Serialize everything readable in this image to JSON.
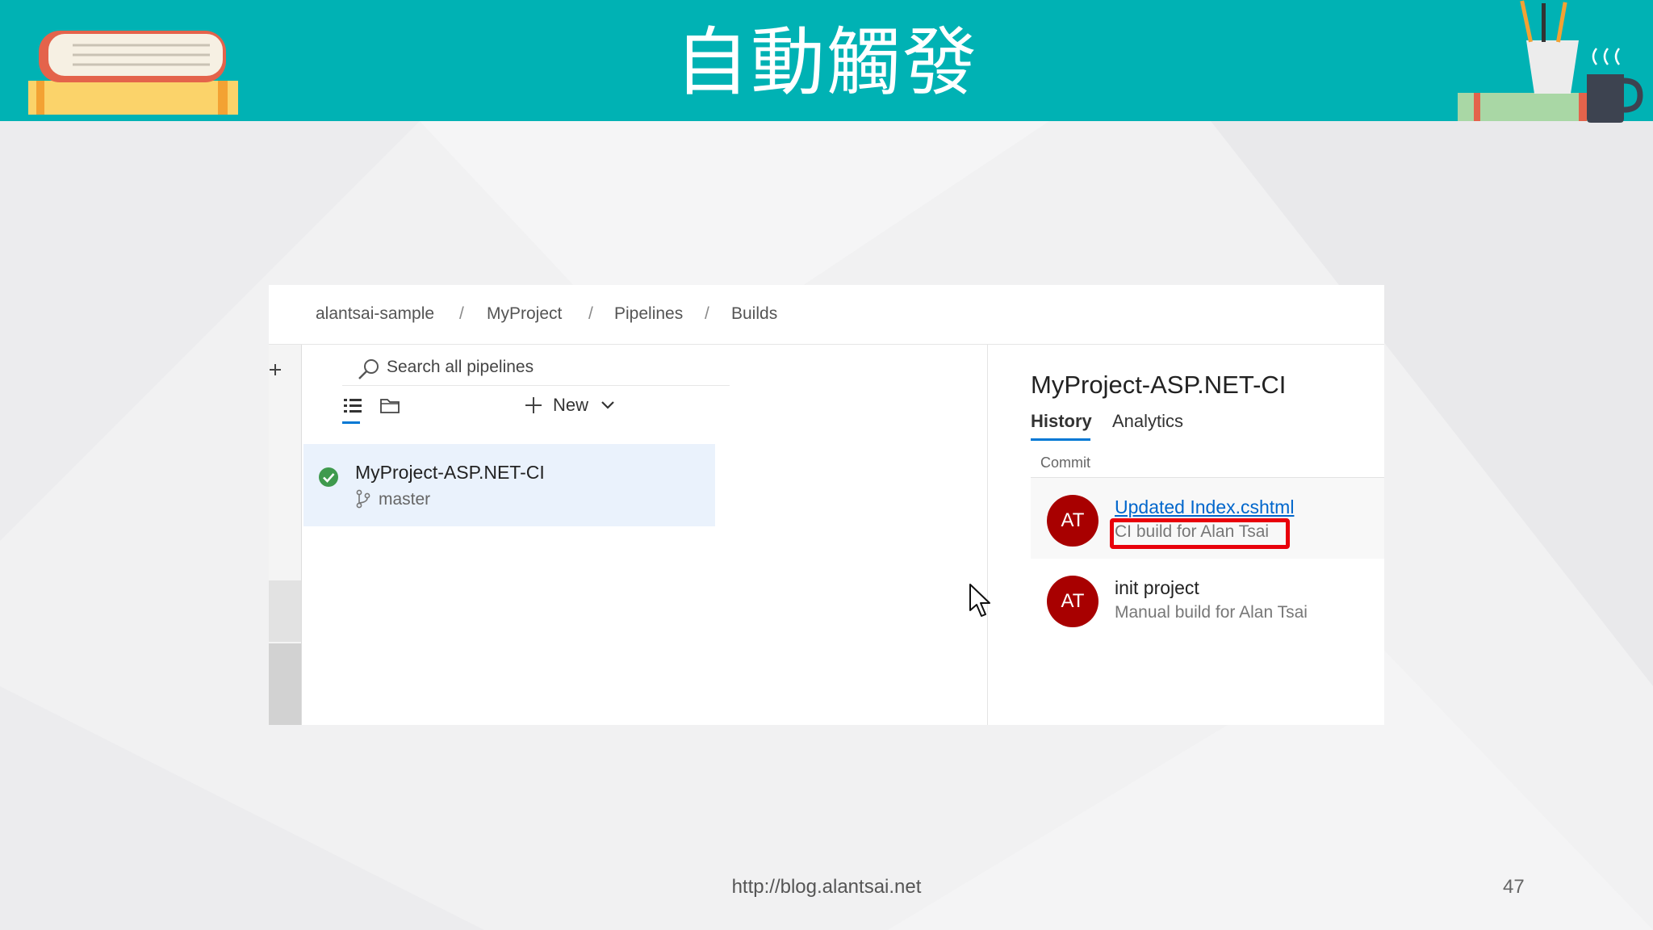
{
  "slide": {
    "title": "自動觸發",
    "footer_url": "http://blog.alantsai.net",
    "page_number": "47"
  },
  "breadcrumb": {
    "items": [
      "alantsai-sample",
      "MyProject",
      "Pipelines",
      "Builds"
    ],
    "separator": "/"
  },
  "pipelines_list": {
    "search_placeholder": "Search all pipelines",
    "new_label": "New",
    "selected_pipeline": {
      "name": "MyProject-ASP.NET-CI",
      "branch": "master",
      "status": "succeeded"
    }
  },
  "detail": {
    "title": "MyProject-ASP.NET-CI",
    "tabs": [
      "History",
      "Analytics"
    ],
    "active_tab": "History",
    "column_header": "Commit",
    "runs": [
      {
        "avatar": "AT",
        "title": "Updated Index.cshtml",
        "subtitle": "CI build for Alan Tsai",
        "highlighted": true
      },
      {
        "avatar": "AT",
        "title": "init project",
        "subtitle": "Manual build for Alan Tsai",
        "highlighted": false
      }
    ]
  },
  "colors": {
    "banner": "#00b2b4",
    "accent_blue": "#0078d4",
    "avatar": "#a80000",
    "highlight": "#e8000b",
    "success": "#3f9a4d"
  }
}
